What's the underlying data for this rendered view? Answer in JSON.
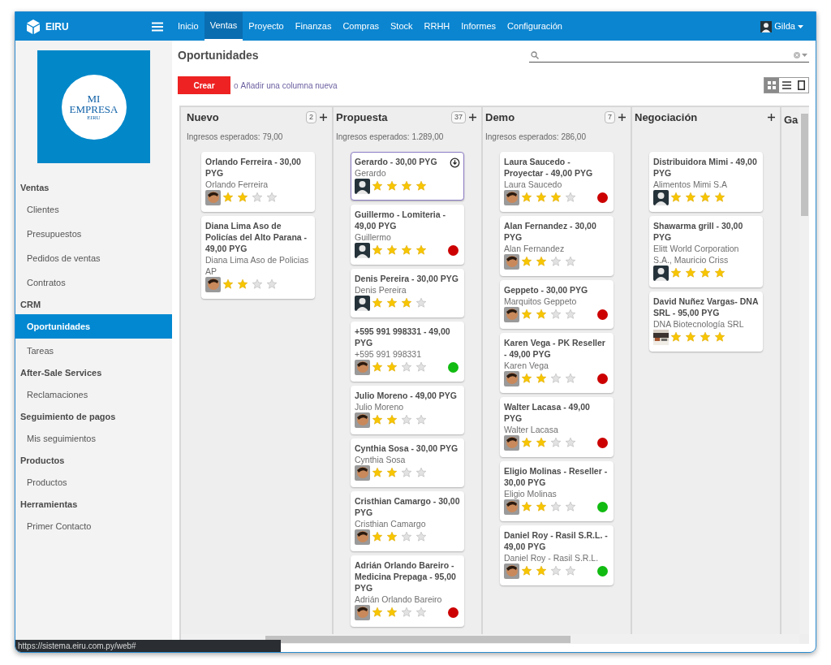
{
  "brand": {
    "name": "EIRU"
  },
  "nav": [
    {
      "label": "Inicio",
      "selected": false
    },
    {
      "label": "Ventas",
      "selected": true
    },
    {
      "label": "Proyecto",
      "selected": false
    },
    {
      "label": "Finanzas",
      "selected": false
    },
    {
      "label": "Compras",
      "selected": false
    },
    {
      "label": "Stock",
      "selected": false
    },
    {
      "label": "RRHH",
      "selected": false
    },
    {
      "label": "Informes",
      "selected": false
    },
    {
      "label": "Configuración",
      "selected": false
    }
  ],
  "user": {
    "name": "Gilda"
  },
  "company_logo": {
    "line1": "MI",
    "line2": "EMPRESA",
    "line3": "EIRU"
  },
  "sidebar": [
    {
      "heading": "Ventas",
      "items": [
        {
          "label": "Clientes",
          "selected": false
        },
        {
          "label": "Presupuestos",
          "selected": false
        },
        {
          "label": "Pedidos de ventas",
          "selected": false
        },
        {
          "label": "Contratos",
          "selected": false
        }
      ]
    },
    {
      "heading": "CRM",
      "items": [
        {
          "label": "Oportunidades",
          "selected": true
        },
        {
          "label": "Tareas",
          "selected": false
        }
      ]
    },
    {
      "heading": "After-Sale Services",
      "items": [
        {
          "label": "Reclamaciones",
          "selected": false
        }
      ]
    },
    {
      "heading": "Seguimiento de pagos",
      "items": [
        {
          "label": "Mis seguimientos",
          "selected": false
        }
      ]
    },
    {
      "heading": "Productos",
      "items": [
        {
          "label": "Productos",
          "selected": false
        }
      ]
    },
    {
      "heading": "Herramientas",
      "items": [
        {
          "label": "Primer Contacto",
          "selected": false
        }
      ]
    }
  ],
  "page_title": "Oportunidades",
  "create_button": "Crear",
  "or_text": "o",
  "add_column_link": "Añadir una columna nueva",
  "views": [
    {
      "kind": "kanban",
      "selected": true
    },
    {
      "kind": "list",
      "selected": false
    },
    {
      "kind": "form",
      "selected": false
    }
  ],
  "columns": [
    {
      "title": "Nuevo",
      "count": "2",
      "subtitle": "Ingresos esperados: 79,00",
      "cards": [
        {
          "title": "Orlando Ferreira - 30,00 PYG",
          "contact": "Orlando Ferreira",
          "stars": 2,
          "selected": false
        },
        {
          "title": "Diana Lima Aso de Policías del Alto Parana - 49,00 PYG",
          "contact": "Diana Lima Aso de Policias AP",
          "stars": 2,
          "selected": false
        }
      ]
    },
    {
      "title": "Propuesta",
      "count": "37",
      "subtitle": "Ingresos esperados: 1.289,00",
      "cards": [
        {
          "title": "Gerardo - 30,00 PYG",
          "contact": "Gerardo",
          "kind": "silhouette",
          "stars": 4,
          "selected": true
        },
        {
          "title": "Guillermo - Lomiteria - 49,00 PYG",
          "contact": "Guillermo",
          "kind": "silhouette",
          "stars": 4,
          "selected": false,
          "color": "#cc0000"
        },
        {
          "title": "Denis Pereira - 30,00 PYG",
          "contact": "Denis Pereira",
          "kind": "silhouette",
          "stars": 3,
          "selected": false
        },
        {
          "title": "+595 991 998331 - 49,00 PYG",
          "contact": "+595 991 998331",
          "stars": 2,
          "selected": false,
          "color": "#11bb11"
        },
        {
          "title": "Julio Moreno - 49,00 PYG",
          "contact": "Julio Moreno",
          "stars": 2,
          "selected": false
        },
        {
          "title": "Cynthia Sosa - 30,00 PYG",
          "contact": "Cynthia Sosa",
          "stars": 2,
          "selected": false
        },
        {
          "title": "Cristhian Camargo - 30,00 PYG",
          "contact": "Cristhian Camargo",
          "stars": 2,
          "selected": false
        },
        {
          "title": "Adrián Orlando Bareiro - Medicina Prepaga - 95,00 PYG",
          "contact": "Adrián Orlando Bareiro",
          "stars": 2,
          "selected": false,
          "color": "#cc0000"
        }
      ]
    },
    {
      "title": "Demo",
      "count": "7",
      "subtitle": "Ingresos esperados: 286,00",
      "cards": [
        {
          "title": "Laura Saucedo - Proyectar - 49,00 PYG",
          "contact": "Laura Saucedo",
          "stars": 3,
          "selected": false,
          "color": "#cc0000"
        },
        {
          "title": "Alan Fernandez - 30,00 PYG",
          "contact": "Alan Fernandez",
          "stars": 2,
          "selected": false
        },
        {
          "title": "Geppeto - 30,00 PYG",
          "contact": "Marquitos Geppeto",
          "stars": 2,
          "selected": false,
          "color": "#cc0000"
        },
        {
          "title": "Karen Vega - PK Reseller - 49,00 PYG",
          "contact": "Karen Vega",
          "stars": 2,
          "selected": false,
          "color": "#cc0000"
        },
        {
          "title": "Walter Lacasa - 49,00 PYG",
          "contact": "Walter Lacasa",
          "stars": 2,
          "selected": false,
          "color": "#cc0000"
        },
        {
          "title": "Eligio Molinas - Reseller - 30,00 PYG",
          "contact": "Eligio Molinas",
          "stars": 2,
          "selected": false,
          "color": "#11bb11"
        },
        {
          "title": "Daniel Roy - Rasil S.R.L. - 49,00 PYG",
          "contact": "Daniel Roy - Rasil S.R.L.",
          "stars": 2,
          "selected": false,
          "color": "#11bb11"
        }
      ]
    },
    {
      "title": "Negociación",
      "cards": [
        {
          "title": "Distribuidora Mimi - 49,00 PYG",
          "contact": "Alimentos Mimi S.A",
          "kind": "silhouette",
          "stars": 4,
          "selected": false
        },
        {
          "title": "Shawarma grill - 30,00 PYG",
          "contact": "Elitt World Corporation S.A., Mauricio Criss",
          "kind": "silhouette",
          "stars": 4,
          "selected": false
        },
        {
          "title": "David Nuñez Vargas- DNA SRL - 95,00 PYG",
          "contact": "DNA Biotecnología SRL",
          "kind": "picture",
          "stars": 4,
          "selected": false
        }
      ]
    },
    {
      "title": "Ga"
    }
  ],
  "status_url": "https://sistema.eiru.com.py/web#"
}
